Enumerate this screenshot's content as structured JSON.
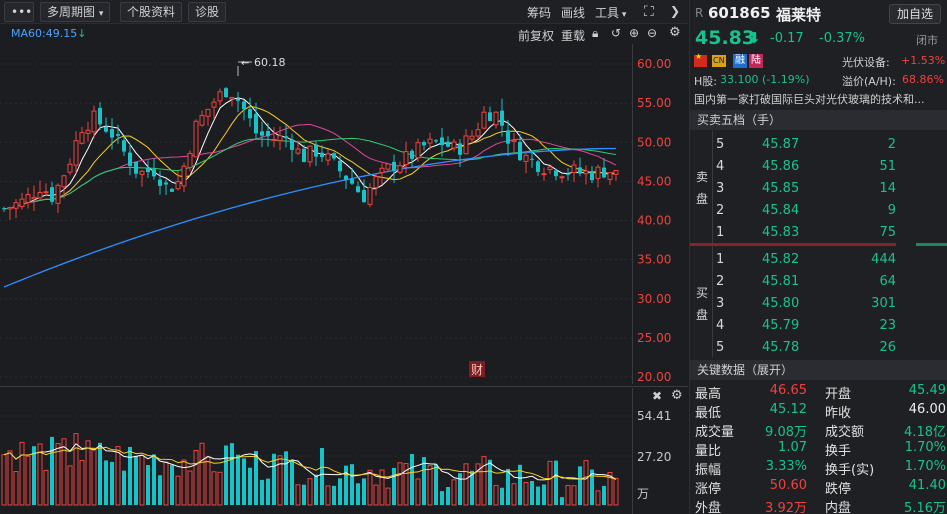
{
  "toolbar": {
    "menu_icon": "menu-dots-icon",
    "period": "多周期图",
    "stock_info": "个股资料",
    "diagnose": "诊股",
    "chips": "筹码",
    "draw": "画线",
    "tools": "工具",
    "expand_icon": "expand-icon"
  },
  "ma_indicator": {
    "label": "MA60:49.15",
    "trend": "↓"
  },
  "chart_controls": {
    "adjust": "前复权",
    "reset": "重载"
  },
  "price_axis": [
    "60.00",
    "55.00",
    "50.00",
    "45.00",
    "40.00",
    "35.00",
    "30.00",
    "25.00",
    "20.00"
  ],
  "peak_label": "60.18",
  "finance_marker": "财",
  "volume_axis": [
    "54.41",
    "27.20",
    "万"
  ],
  "stock": {
    "prefix": "R",
    "code": "601865",
    "name": "福莱特",
    "price": "45.83",
    "change": "-0.17",
    "change_pct": "-0.37%",
    "status": "闭市",
    "watch_button": "加自选",
    "sector": "光伏设备:",
    "sector_pct": "+1.53%",
    "tags": [
      "CN",
      "融",
      "陆"
    ],
    "h_share_label": "H股:",
    "h_share": "33.100 (-1.19%)",
    "premium_label": "溢价(A/H):",
    "premium": "68.86%",
    "description": "国内第一家打破国际巨头对光伏玻璃的技术和..."
  },
  "order_book": {
    "title": "买卖五档（手）",
    "sell_label": [
      "卖",
      "盘"
    ],
    "buy_label": [
      "买",
      "盘"
    ],
    "asks": [
      {
        "level": "5",
        "price": "45.87",
        "vol": "2"
      },
      {
        "level": "4",
        "price": "45.86",
        "vol": "51"
      },
      {
        "level": "3",
        "price": "45.85",
        "vol": "14"
      },
      {
        "level": "2",
        "price": "45.84",
        "vol": "9"
      },
      {
        "level": "1",
        "price": "45.83",
        "vol": "75"
      }
    ],
    "bids": [
      {
        "level": "1",
        "price": "45.82",
        "vol": "444"
      },
      {
        "level": "2",
        "price": "45.81",
        "vol": "64"
      },
      {
        "level": "3",
        "price": "45.80",
        "vol": "301"
      },
      {
        "level": "4",
        "price": "45.79",
        "vol": "23"
      },
      {
        "level": "5",
        "price": "45.78",
        "vol": "26"
      }
    ]
  },
  "key_data": {
    "title": "关键数据（展开）",
    "rows": [
      {
        "l1": "最高",
        "v1": "46.65",
        "c1": "red",
        "l2": "开盘",
        "v2": "45.49",
        "c2": "green"
      },
      {
        "l1": "最低",
        "v1": "45.12",
        "c1": "green",
        "l2": "昨收",
        "v2": "46.00",
        "c2": "white"
      },
      {
        "l1": "成交量",
        "v1": "9.08万",
        "c1": "green",
        "l2": "成交额",
        "v2": "4.18亿",
        "c2": "green"
      },
      {
        "l1": "量比",
        "v1": "1.07",
        "c1": "green",
        "l2": "换手",
        "v2": "1.70%",
        "c2": "green"
      },
      {
        "l1": "振幅",
        "v1": "3.33%",
        "c1": "green",
        "l2": "换手(实)",
        "v2": "1.70%",
        "c2": "green"
      },
      {
        "l1": "涨停",
        "v1": "50.60",
        "c1": "red",
        "l2": "跌停",
        "v2": "41.40",
        "c2": "green"
      },
      {
        "l1": "外盘",
        "v1": "3.92万",
        "c1": "red",
        "l2": "内盘",
        "v2": "5.16万",
        "c2": "green"
      }
    ]
  },
  "colors": {
    "up": "#f0413d",
    "down": "#16c3c8",
    "ma5": "#ffffff",
    "ma10": "#f5d020",
    "ma20": "#e0479c",
    "ma30": "#2ecc71",
    "ma60": "#2f8fff"
  }
}
